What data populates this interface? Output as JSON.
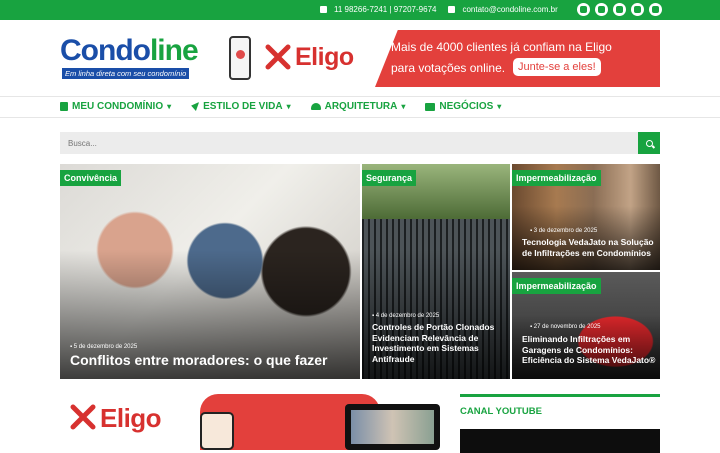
{
  "topbar": {
    "phone": "11 98266-7241 | 97207-9674",
    "email": "contato@condoline.com.br",
    "socials": [
      "facebook-icon",
      "youtube-icon",
      "linkedin-icon",
      "whatsapp-icon",
      "instagram-icon"
    ]
  },
  "logo": {
    "word_a": "Condo",
    "word_b": "line",
    "tagline": "Em linha direta com seu condomínio"
  },
  "banner": {
    "brand": "Eligo",
    "line1": "Mais de 4000 clientes já confiam na Eligo",
    "line2": "para votações online.",
    "cta": "Junte-se a eles!"
  },
  "nav": [
    {
      "label": "MEU CONDOMÍNIO",
      "icon": "building-icon"
    },
    {
      "label": "ESTILO DE VIDA",
      "icon": "paper-plane-icon"
    },
    {
      "label": "ARQUITETURA",
      "icon": "hard-hat-icon"
    },
    {
      "label": "NEGÓCIOS",
      "icon": "briefcase-icon"
    }
  ],
  "search": {
    "placeholder": "Busca..."
  },
  "featured": [
    {
      "category": "Convivência",
      "date": "5 de dezembro de 2025",
      "title": "Conflitos entre moradores: o que fazer"
    },
    {
      "category": "Segurança",
      "date": "4 de dezembro de 2025",
      "title": "Controles de Portão Clonados Evidenciam Relevância de Investimento em Sistemas Antifraude"
    },
    {
      "category": "Impermeabilização",
      "date": "3 de dezembro de 2025",
      "title": "Tecnologia VedaJato na Solução de Infiltrações em Condomínios"
    },
    {
      "category": "Impermeabilização",
      "date": "27 de novembro de 2025",
      "title": "Eliminando Infiltrações em Garagens de Condomínios: Eficiência do Sistema VedaJato®"
    }
  ],
  "promo": {
    "brand": "Eligo"
  },
  "sidebar": {
    "heading": "CANAL YOUTUBE"
  },
  "colors": {
    "accent": "#18a340",
    "brand_blue": "#1a4ea8",
    "eligo_red": "#e3403c"
  }
}
